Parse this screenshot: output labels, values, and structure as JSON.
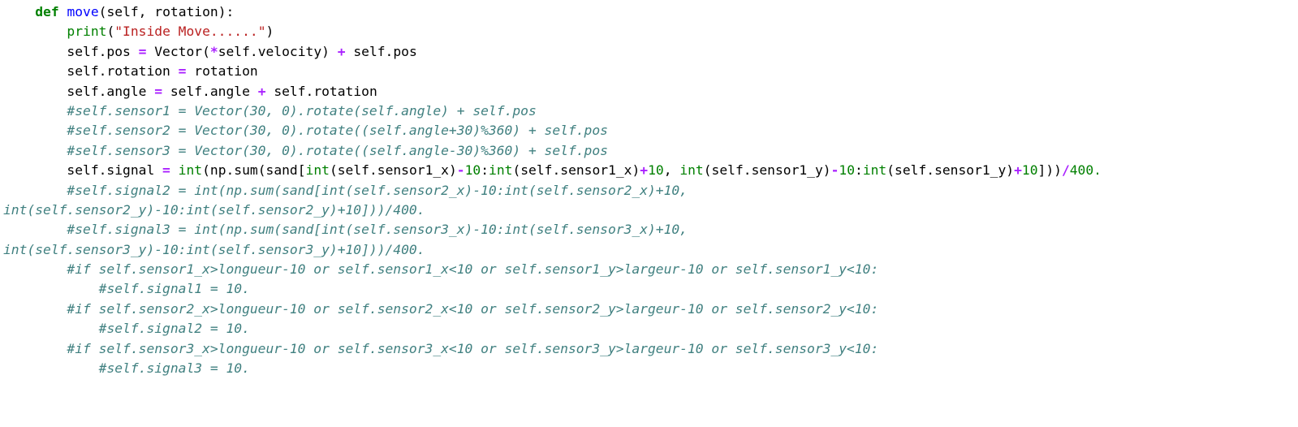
{
  "code_lines": [
    {
      "tokens": [
        {
          "t": "    ",
          "c": ""
        },
        {
          "t": "def",
          "c": "kw"
        },
        {
          "t": " ",
          "c": ""
        },
        {
          "t": "move",
          "c": "fn"
        },
        {
          "t": "(self, rotation):",
          "c": ""
        }
      ]
    },
    {
      "tokens": [
        {
          "t": "        ",
          "c": ""
        },
        {
          "t": "print",
          "c": "bi"
        },
        {
          "t": "(",
          "c": ""
        },
        {
          "t": "\"Inside Move......\"",
          "c": "str"
        },
        {
          "t": ")",
          "c": ""
        }
      ]
    },
    {
      "tokens": [
        {
          "t": "        self.pos ",
          "c": ""
        },
        {
          "t": "=",
          "c": "op"
        },
        {
          "t": " Vector(",
          "c": ""
        },
        {
          "t": "*",
          "c": "op"
        },
        {
          "t": "self.velocity) ",
          "c": ""
        },
        {
          "t": "+",
          "c": "op"
        },
        {
          "t": " self.pos",
          "c": ""
        }
      ]
    },
    {
      "tokens": [
        {
          "t": "        self.rotation ",
          "c": ""
        },
        {
          "t": "=",
          "c": "op"
        },
        {
          "t": " rotation",
          "c": ""
        }
      ]
    },
    {
      "tokens": [
        {
          "t": "        self.angle ",
          "c": ""
        },
        {
          "t": "=",
          "c": "op"
        },
        {
          "t": " self.angle ",
          "c": ""
        },
        {
          "t": "+",
          "c": "op"
        },
        {
          "t": " self.rotation",
          "c": ""
        }
      ]
    },
    {
      "tokens": [
        {
          "t": "        ",
          "c": ""
        },
        {
          "t": "#self.sensor1 = Vector(30, 0).rotate(self.angle) + self.pos",
          "c": "cm"
        }
      ]
    },
    {
      "tokens": [
        {
          "t": "        ",
          "c": ""
        },
        {
          "t": "#self.sensor2 = Vector(30, 0).rotate((self.angle+30)%360) + self.pos",
          "c": "cm"
        }
      ]
    },
    {
      "tokens": [
        {
          "t": "        ",
          "c": ""
        },
        {
          "t": "#self.sensor3 = Vector(30, 0).rotate((self.angle-30)%360) + self.pos",
          "c": "cm"
        }
      ]
    },
    {
      "tokens": [
        {
          "t": "        self.signal ",
          "c": ""
        },
        {
          "t": "=",
          "c": "op"
        },
        {
          "t": " ",
          "c": ""
        },
        {
          "t": "int",
          "c": "bi"
        },
        {
          "t": "(np.sum(sand[",
          "c": ""
        },
        {
          "t": "int",
          "c": "bi"
        },
        {
          "t": "(self.sensor1_x)",
          "c": ""
        },
        {
          "t": "-",
          "c": "op"
        },
        {
          "t": "10",
          "c": "num"
        },
        {
          "t": ":",
          "c": ""
        },
        {
          "t": "int",
          "c": "bi"
        },
        {
          "t": "(self.sensor1_x)",
          "c": ""
        },
        {
          "t": "+",
          "c": "op"
        },
        {
          "t": "10",
          "c": "num"
        },
        {
          "t": ", ",
          "c": ""
        },
        {
          "t": "int",
          "c": "bi"
        },
        {
          "t": "(self.sensor1_y)",
          "c": ""
        },
        {
          "t": "-",
          "c": "op"
        },
        {
          "t": "10",
          "c": "num"
        },
        {
          "t": ":",
          "c": ""
        },
        {
          "t": "int",
          "c": "bi"
        },
        {
          "t": "(self.sensor1_y)",
          "c": ""
        },
        {
          "t": "+",
          "c": "op"
        },
        {
          "t": "10",
          "c": "num"
        },
        {
          "t": "]))",
          "c": ""
        },
        {
          "t": "/",
          "c": "op"
        },
        {
          "t": "400.",
          "c": "num"
        }
      ]
    },
    {
      "tokens": [
        {
          "t": "        ",
          "c": ""
        },
        {
          "t": "#self.signal2 = int(np.sum(sand[int(self.sensor2_x)-10:int(self.sensor2_x)+10,",
          "c": "cm"
        }
      ]
    },
    {
      "tokens": [
        {
          "t": "int(self.sensor2_y)-10:int(self.sensor2_y)+10]))/400.",
          "c": "cm"
        }
      ]
    },
    {
      "tokens": [
        {
          "t": "        ",
          "c": ""
        },
        {
          "t": "#self.signal3 = int(np.sum(sand[int(self.sensor3_x)-10:int(self.sensor3_x)+10,",
          "c": "cm"
        }
      ]
    },
    {
      "tokens": [
        {
          "t": "int(self.sensor3_y)-10:int(self.sensor3_y)+10]))/400.",
          "c": "cm"
        }
      ]
    },
    {
      "tokens": [
        {
          "t": "        ",
          "c": ""
        },
        {
          "t": "#if self.sensor1_x>longueur-10 or self.sensor1_x<10 or self.sensor1_y>largeur-10 or self.sensor1_y<10:",
          "c": "cm"
        }
      ]
    },
    {
      "tokens": [
        {
          "t": "            ",
          "c": ""
        },
        {
          "t": "#self.signal1 = 10.",
          "c": "cm"
        }
      ]
    },
    {
      "tokens": [
        {
          "t": "        ",
          "c": ""
        },
        {
          "t": "#if self.sensor2_x>longueur-10 or self.sensor2_x<10 or self.sensor2_y>largeur-10 or self.sensor2_y<10:",
          "c": "cm"
        }
      ]
    },
    {
      "tokens": [
        {
          "t": "            ",
          "c": ""
        },
        {
          "t": "#self.signal2 = 10.",
          "c": "cm"
        }
      ]
    },
    {
      "tokens": [
        {
          "t": "        ",
          "c": ""
        },
        {
          "t": "#if self.sensor3_x>longueur-10 or self.sensor3_x<10 or self.sensor3_y>largeur-10 or self.sensor3_y<10:",
          "c": "cm"
        }
      ]
    },
    {
      "tokens": [
        {
          "t": "            ",
          "c": ""
        },
        {
          "t": "#self.signal3 = 10.",
          "c": "cm"
        }
      ]
    }
  ],
  "colors": {
    "background": "#ffffff",
    "keyword": "#008000",
    "function_name": "#0000ff",
    "builtin": "#008000",
    "string": "#ba2121",
    "operator": "#aa22ff",
    "number": "#008000",
    "comment": "#408080"
  }
}
